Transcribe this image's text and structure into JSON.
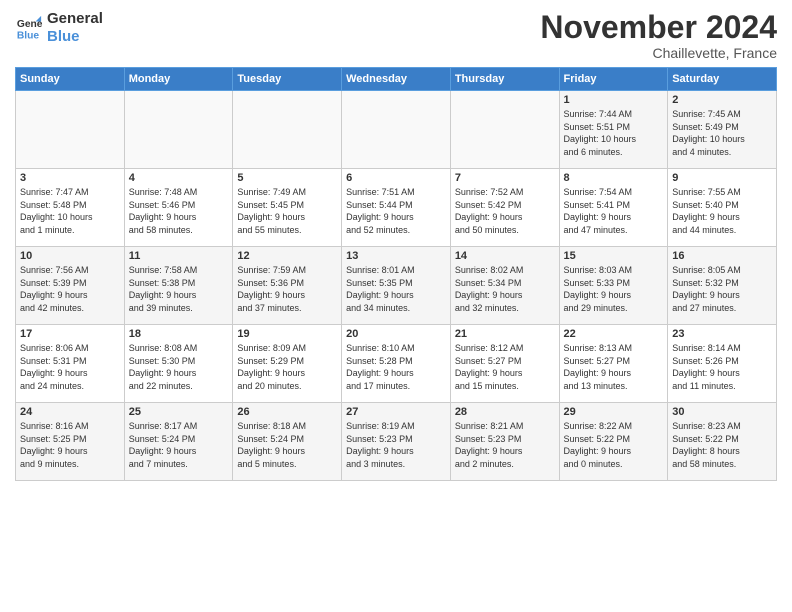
{
  "logo": {
    "line1": "General",
    "line2": "Blue"
  },
  "title": "November 2024",
  "location": "Chaillevette, France",
  "days_header": [
    "Sunday",
    "Monday",
    "Tuesday",
    "Wednesday",
    "Thursday",
    "Friday",
    "Saturday"
  ],
  "weeks": [
    [
      {
        "day": "",
        "info": ""
      },
      {
        "day": "",
        "info": ""
      },
      {
        "day": "",
        "info": ""
      },
      {
        "day": "",
        "info": ""
      },
      {
        "day": "",
        "info": ""
      },
      {
        "day": "1",
        "info": "Sunrise: 7:44 AM\nSunset: 5:51 PM\nDaylight: 10 hours\nand 6 minutes."
      },
      {
        "day": "2",
        "info": "Sunrise: 7:45 AM\nSunset: 5:49 PM\nDaylight: 10 hours\nand 4 minutes."
      }
    ],
    [
      {
        "day": "3",
        "info": "Sunrise: 7:47 AM\nSunset: 5:48 PM\nDaylight: 10 hours\nand 1 minute."
      },
      {
        "day": "4",
        "info": "Sunrise: 7:48 AM\nSunset: 5:46 PM\nDaylight: 9 hours\nand 58 minutes."
      },
      {
        "day": "5",
        "info": "Sunrise: 7:49 AM\nSunset: 5:45 PM\nDaylight: 9 hours\nand 55 minutes."
      },
      {
        "day": "6",
        "info": "Sunrise: 7:51 AM\nSunset: 5:44 PM\nDaylight: 9 hours\nand 52 minutes."
      },
      {
        "day": "7",
        "info": "Sunrise: 7:52 AM\nSunset: 5:42 PM\nDaylight: 9 hours\nand 50 minutes."
      },
      {
        "day": "8",
        "info": "Sunrise: 7:54 AM\nSunset: 5:41 PM\nDaylight: 9 hours\nand 47 minutes."
      },
      {
        "day": "9",
        "info": "Sunrise: 7:55 AM\nSunset: 5:40 PM\nDaylight: 9 hours\nand 44 minutes."
      }
    ],
    [
      {
        "day": "10",
        "info": "Sunrise: 7:56 AM\nSunset: 5:39 PM\nDaylight: 9 hours\nand 42 minutes."
      },
      {
        "day": "11",
        "info": "Sunrise: 7:58 AM\nSunset: 5:38 PM\nDaylight: 9 hours\nand 39 minutes."
      },
      {
        "day": "12",
        "info": "Sunrise: 7:59 AM\nSunset: 5:36 PM\nDaylight: 9 hours\nand 37 minutes."
      },
      {
        "day": "13",
        "info": "Sunrise: 8:01 AM\nSunset: 5:35 PM\nDaylight: 9 hours\nand 34 minutes."
      },
      {
        "day": "14",
        "info": "Sunrise: 8:02 AM\nSunset: 5:34 PM\nDaylight: 9 hours\nand 32 minutes."
      },
      {
        "day": "15",
        "info": "Sunrise: 8:03 AM\nSunset: 5:33 PM\nDaylight: 9 hours\nand 29 minutes."
      },
      {
        "day": "16",
        "info": "Sunrise: 8:05 AM\nSunset: 5:32 PM\nDaylight: 9 hours\nand 27 minutes."
      }
    ],
    [
      {
        "day": "17",
        "info": "Sunrise: 8:06 AM\nSunset: 5:31 PM\nDaylight: 9 hours\nand 24 minutes."
      },
      {
        "day": "18",
        "info": "Sunrise: 8:08 AM\nSunset: 5:30 PM\nDaylight: 9 hours\nand 22 minutes."
      },
      {
        "day": "19",
        "info": "Sunrise: 8:09 AM\nSunset: 5:29 PM\nDaylight: 9 hours\nand 20 minutes."
      },
      {
        "day": "20",
        "info": "Sunrise: 8:10 AM\nSunset: 5:28 PM\nDaylight: 9 hours\nand 17 minutes."
      },
      {
        "day": "21",
        "info": "Sunrise: 8:12 AM\nSunset: 5:27 PM\nDaylight: 9 hours\nand 15 minutes."
      },
      {
        "day": "22",
        "info": "Sunrise: 8:13 AM\nSunset: 5:27 PM\nDaylight: 9 hours\nand 13 minutes."
      },
      {
        "day": "23",
        "info": "Sunrise: 8:14 AM\nSunset: 5:26 PM\nDaylight: 9 hours\nand 11 minutes."
      }
    ],
    [
      {
        "day": "24",
        "info": "Sunrise: 8:16 AM\nSunset: 5:25 PM\nDaylight: 9 hours\nand 9 minutes."
      },
      {
        "day": "25",
        "info": "Sunrise: 8:17 AM\nSunset: 5:24 PM\nDaylight: 9 hours\nand 7 minutes."
      },
      {
        "day": "26",
        "info": "Sunrise: 8:18 AM\nSunset: 5:24 PM\nDaylight: 9 hours\nand 5 minutes."
      },
      {
        "day": "27",
        "info": "Sunrise: 8:19 AM\nSunset: 5:23 PM\nDaylight: 9 hours\nand 3 minutes."
      },
      {
        "day": "28",
        "info": "Sunrise: 8:21 AM\nSunset: 5:23 PM\nDaylight: 9 hours\nand 2 minutes."
      },
      {
        "day": "29",
        "info": "Sunrise: 8:22 AM\nSunset: 5:22 PM\nDaylight: 9 hours\nand 0 minutes."
      },
      {
        "day": "30",
        "info": "Sunrise: 8:23 AM\nSunset: 5:22 PM\nDaylight: 8 hours\nand 58 minutes."
      }
    ]
  ]
}
